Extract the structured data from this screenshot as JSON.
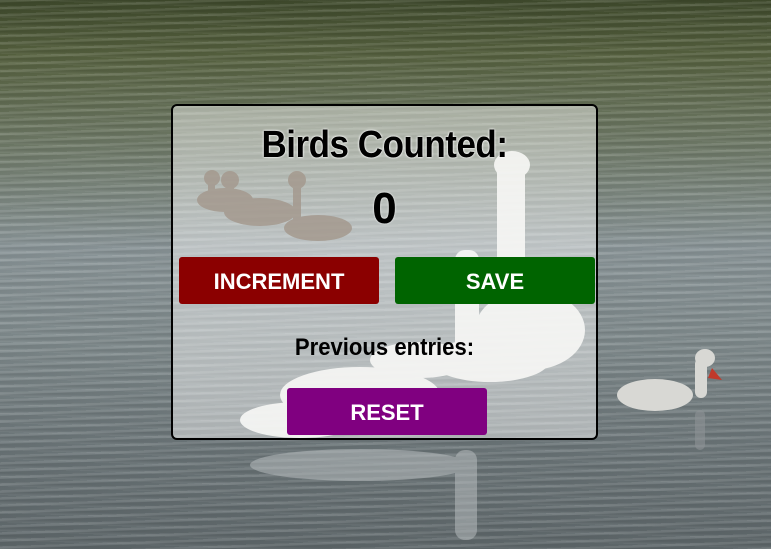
{
  "background": {
    "description_icon": "lake-with-swans-and-ducks"
  },
  "counter": {
    "title": "Birds Counted:",
    "value": "0"
  },
  "buttons": {
    "increment_label": "INCREMENT",
    "save_label": "SAVE",
    "reset_label": "RESET"
  },
  "entries": {
    "label": "Previous entries:"
  },
  "colors": {
    "increment": "#8b0000",
    "save": "#006400",
    "reset": "#800080"
  }
}
